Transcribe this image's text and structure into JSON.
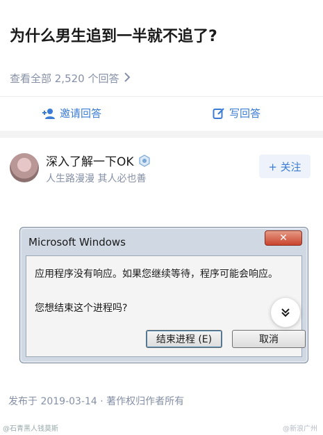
{
  "question": {
    "title": "为什么男生追到一半就不追了?"
  },
  "answers_link": {
    "label": "查看全部 2,520 个回答",
    "chevron": "chevron-right-icon"
  },
  "actions": {
    "invite_label": "邀请回答",
    "write_label": "写回答"
  },
  "author": {
    "name": "深入了解一下OK",
    "bio": "人生路漫漫 其人必也善",
    "follow_label": "+ 关注"
  },
  "dialog": {
    "title": "Microsoft Windows",
    "close_label": "✕",
    "message": "应用程序没有响应。如果您继续等待，程序可能会响应。",
    "question": "您想结束这个进程吗?",
    "end_label": "结束进程 (E)",
    "cancel_label": "取消"
  },
  "footer": {
    "published": "发布于 2019-03-14 · 著作权归作者所有",
    "watermark_left": "@石青黑人钱莫斯",
    "watermark_right": "@新浪广州"
  },
  "colors": {
    "accent": "#3a7bd5",
    "muted": "#8590a6"
  }
}
